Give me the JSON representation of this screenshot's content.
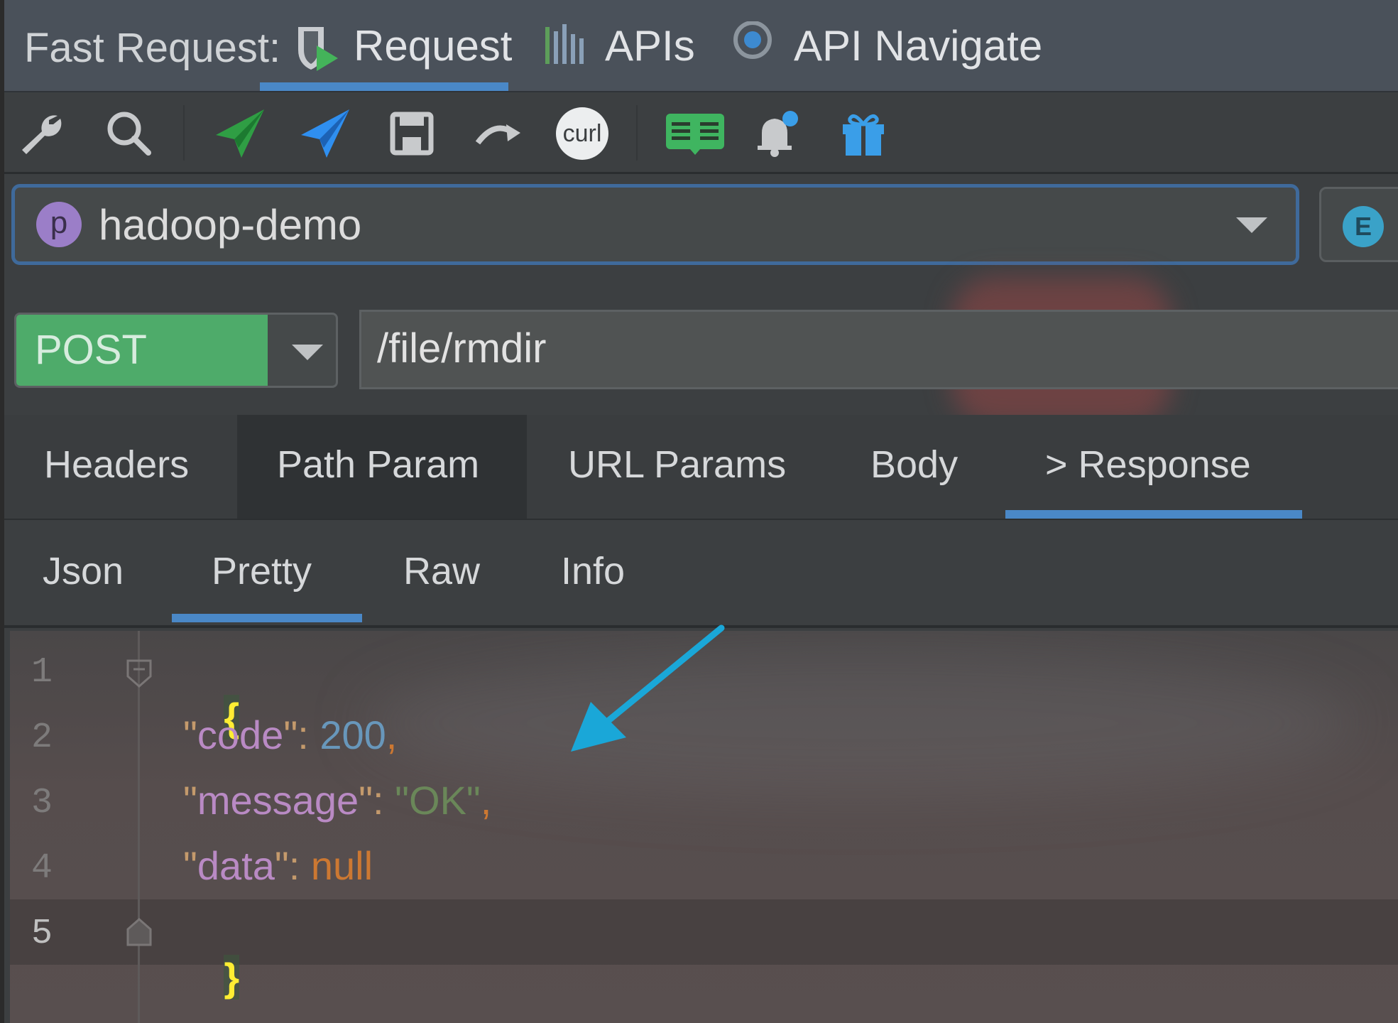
{
  "app": {
    "brand": "Fast Request:"
  },
  "top_tabs": [
    {
      "label": "Request",
      "icon": "request-shield-icon",
      "active": true
    },
    {
      "label": "APIs",
      "icon": "bars-icon",
      "active": false
    },
    {
      "label": "API Navigate",
      "icon": "target-icon",
      "active": false
    }
  ],
  "toolbar": {
    "curl_label": "curl",
    "icons": [
      "wrench-icon",
      "search-icon",
      "send-green-icon",
      "send-blue-icon",
      "save-icon",
      "redo-icon",
      "curl-icon",
      "book-icon",
      "bell-icon",
      "gift-icon"
    ]
  },
  "project": {
    "badge": "p",
    "name": "hadoop-demo"
  },
  "environment": {
    "badge": "E"
  },
  "request": {
    "method": "POST",
    "url": "/file/rmdir"
  },
  "request_tabs": [
    {
      "label": "Headers",
      "active": false
    },
    {
      "label": "Path Param",
      "active": false
    },
    {
      "label": "URL Params",
      "active": false
    },
    {
      "label": "Body",
      "active": false
    },
    {
      "label": "> Response",
      "active": true
    }
  ],
  "response_tabs": [
    {
      "label": "Json",
      "active": false
    },
    {
      "label": "Pretty",
      "active": true
    },
    {
      "label": "Raw",
      "active": false
    },
    {
      "label": "Info",
      "active": false
    }
  ],
  "editor": {
    "line_numbers": [
      "1",
      "2",
      "3",
      "4",
      "5"
    ],
    "open_brace": "{",
    "close_brace": "}",
    "lines": [
      {
        "key": "code",
        "value": "200",
        "type": "number",
        "comma": ","
      },
      {
        "key": "message",
        "value": "\"OK\"",
        "type": "string",
        "comma": ","
      },
      {
        "key": "data",
        "value": "null",
        "type": "null",
        "comma": ""
      }
    ]
  },
  "colors": {
    "accent": "#4a88c7",
    "method_post": "#4eab6a",
    "arrow": "#1aa7d8"
  }
}
